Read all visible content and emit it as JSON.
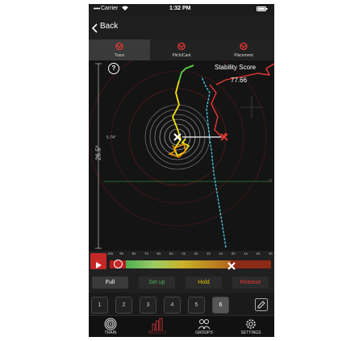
{
  "status_bar": {
    "carrier": "Carrier",
    "time": "1:32 PM"
  },
  "nav": {
    "back_label": "Back"
  },
  "tabs": [
    {
      "label": "Trace",
      "icon": "mantis-logo-icon",
      "active": true
    },
    {
      "label": "Pitch/Cant",
      "icon": "mantis-logo-icon",
      "active": false
    },
    {
      "label": "Placement",
      "icon": "mantis-logo-icon",
      "active": false
    }
  ],
  "trace": {
    "help_label": "?",
    "stability_title": "Stability Score",
    "stability_value": "77.66",
    "angle_label": "26.5°",
    "ring_value_label": "5.74°",
    "axis_zero_label": "0"
  },
  "timeline": {
    "ticks": [
      "10s",
      "9s",
      "8s",
      "7s",
      "6s",
      "5s",
      "4s",
      "3s",
      "2s",
      "1s",
      "0s",
      "1s",
      "2s",
      "3s"
    ],
    "colors": {
      "red": "#b71c1c",
      "green": "#4caf50",
      "yellow": "#c9b229",
      "orange": "#b5651d"
    }
  },
  "phases": {
    "full": "Full",
    "setup": "Set up",
    "hold": "Hold",
    "release": "Release"
  },
  "shots": [
    "1",
    "2",
    "3",
    "4",
    "5",
    "6"
  ],
  "bottom_nav": {
    "train": "TRAIN",
    "results": "RESULTS",
    "groups": "GROUPS",
    "settings": "SETTINGS"
  },
  "colors": {
    "accent": "#e53935",
    "trace_yellow": "#f5e50f",
    "trace_green": "#5bd448",
    "trace_cyan": "#4dd0e1",
    "trace_red": "#e53935"
  }
}
